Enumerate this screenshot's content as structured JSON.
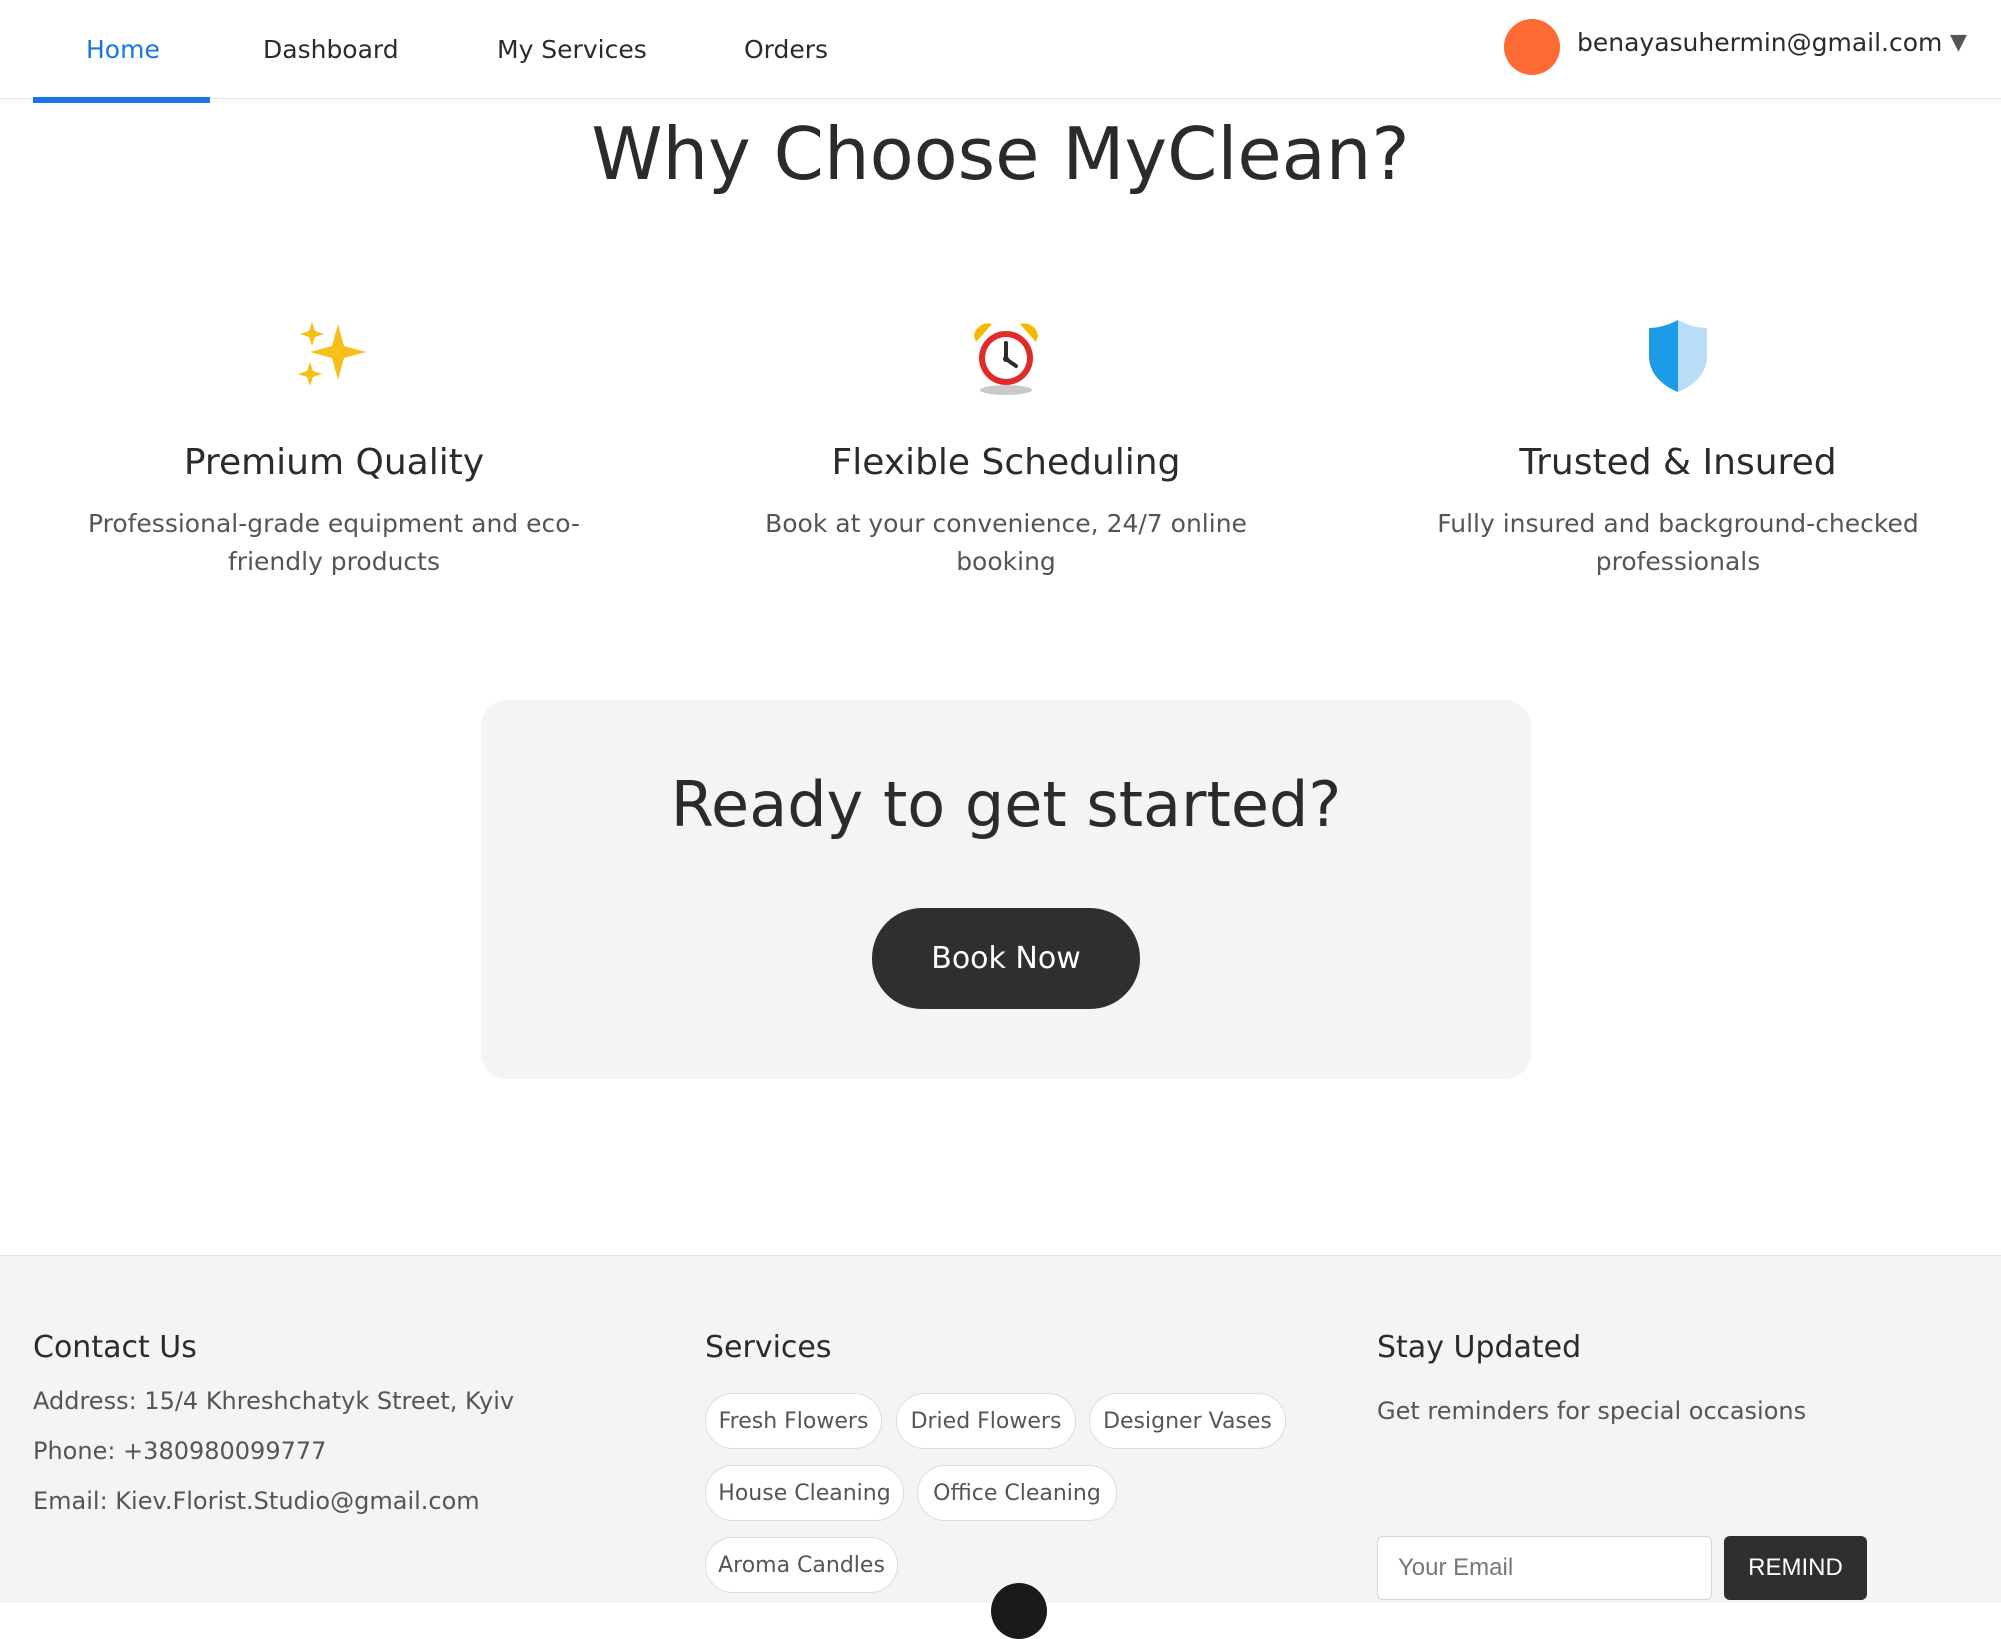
{
  "nav": {
    "tabs": [
      {
        "label": "Home",
        "active": true
      },
      {
        "label": "Dashboard"
      },
      {
        "label": "My Services"
      },
      {
        "label": "Orders"
      }
    ],
    "user_email": "benayasuhermin@gmail.com",
    "dropdown_glyph": "▼",
    "avatar_color": "#ff6b35",
    "accent_color": "#1877e0"
  },
  "features": {
    "title": "Why Choose MyClean?",
    "items": [
      {
        "icon": "sparkles-icon",
        "title": "Premium Quality",
        "desc": "Professional-grade equipment and eco-friendly products"
      },
      {
        "icon": "alarm-clock-icon",
        "title": "Flexible Scheduling",
        "desc": "Book at your convenience, 24/7 online booking"
      },
      {
        "icon": "shield-icon",
        "title": "Trusted & Insured",
        "desc": "Fully insured and background-checked professionals"
      }
    ]
  },
  "cta": {
    "title": "Ready to get started?",
    "button_label": "Book Now"
  },
  "footer": {
    "contact": {
      "heading": "Contact Us",
      "address": "Address: 15/4 Khreshchatyk Street, Kyiv",
      "phone": "Phone: +380980099777",
      "email": "Email: Kiev.Florist.Studio@gmail.com"
    },
    "services": {
      "heading": "Services",
      "chips": [
        "Fresh Flowers",
        "Dried Flowers",
        "Designer Vases",
        "House Cleaning",
        "Office Cleaning",
        "Aroma Candles"
      ]
    },
    "stay_updated": {
      "heading": "Stay Updated",
      "desc": "Get reminders for special occasions",
      "email_placeholder": "Your Email",
      "button_label": "REMIND"
    }
  }
}
